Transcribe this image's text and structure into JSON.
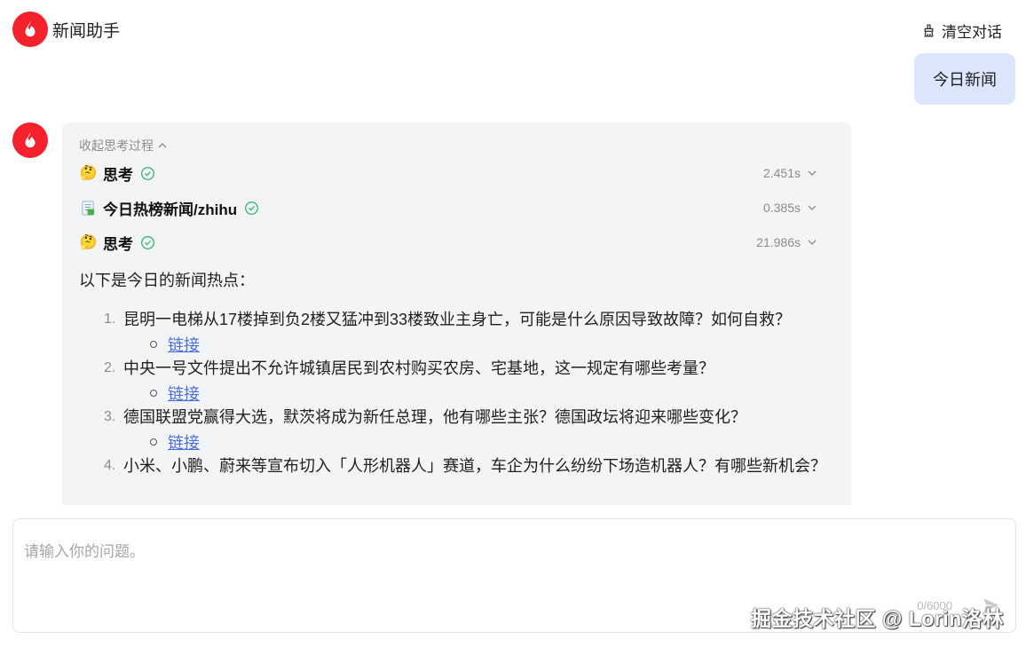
{
  "header": {
    "app_title": "新闻助手",
    "clear_label": "清空对话"
  },
  "user_message": "今日新闻",
  "assistant": {
    "collapse_label": "收起思考过程",
    "steps": [
      {
        "emoji": "🤔",
        "label": "思考",
        "time": "2.451s"
      },
      {
        "emoji": "📄",
        "label": "今日热榜新闻/zhihu",
        "time": "0.385s"
      },
      {
        "emoji": "🤔",
        "label": "思考",
        "time": "21.986s"
      }
    ],
    "intro": "以下是今日的新闻热点：",
    "news": [
      {
        "num": "1.",
        "title": "昆明一电梯从17楼掉到负2楼又猛冲到33楼致业主身亡，可能是什么原因导致故障？如何自救？",
        "link": "链接"
      },
      {
        "num": "2.",
        "title": "中央一号文件提出不允许城镇居民到农村购买农房、宅基地，这一规定有哪些考量？",
        "link": "链接"
      },
      {
        "num": "3.",
        "title": "德国联盟党赢得大选，默茨将成为新任总理，他有哪些主张？德国政坛将迎来哪些变化？",
        "link": "链接"
      },
      {
        "num": "4.",
        "title": "小米、小鹏、蔚来等宣布切入「人形机器人」赛道，车企为什么纷纷下场造机器人？有哪些新机会？",
        "link": ""
      }
    ]
  },
  "input": {
    "placeholder": "请输入你的问题。",
    "value": "",
    "counter": "0/6000"
  },
  "watermark": "掘金技术社区 @ Lorin洛林",
  "colors": {
    "brand": "#f5222d",
    "user_bubble": "#dbe6fd",
    "assistant_bubble": "#f3f4f6",
    "check": "#2fb36b",
    "link": "#4a6fd8"
  }
}
